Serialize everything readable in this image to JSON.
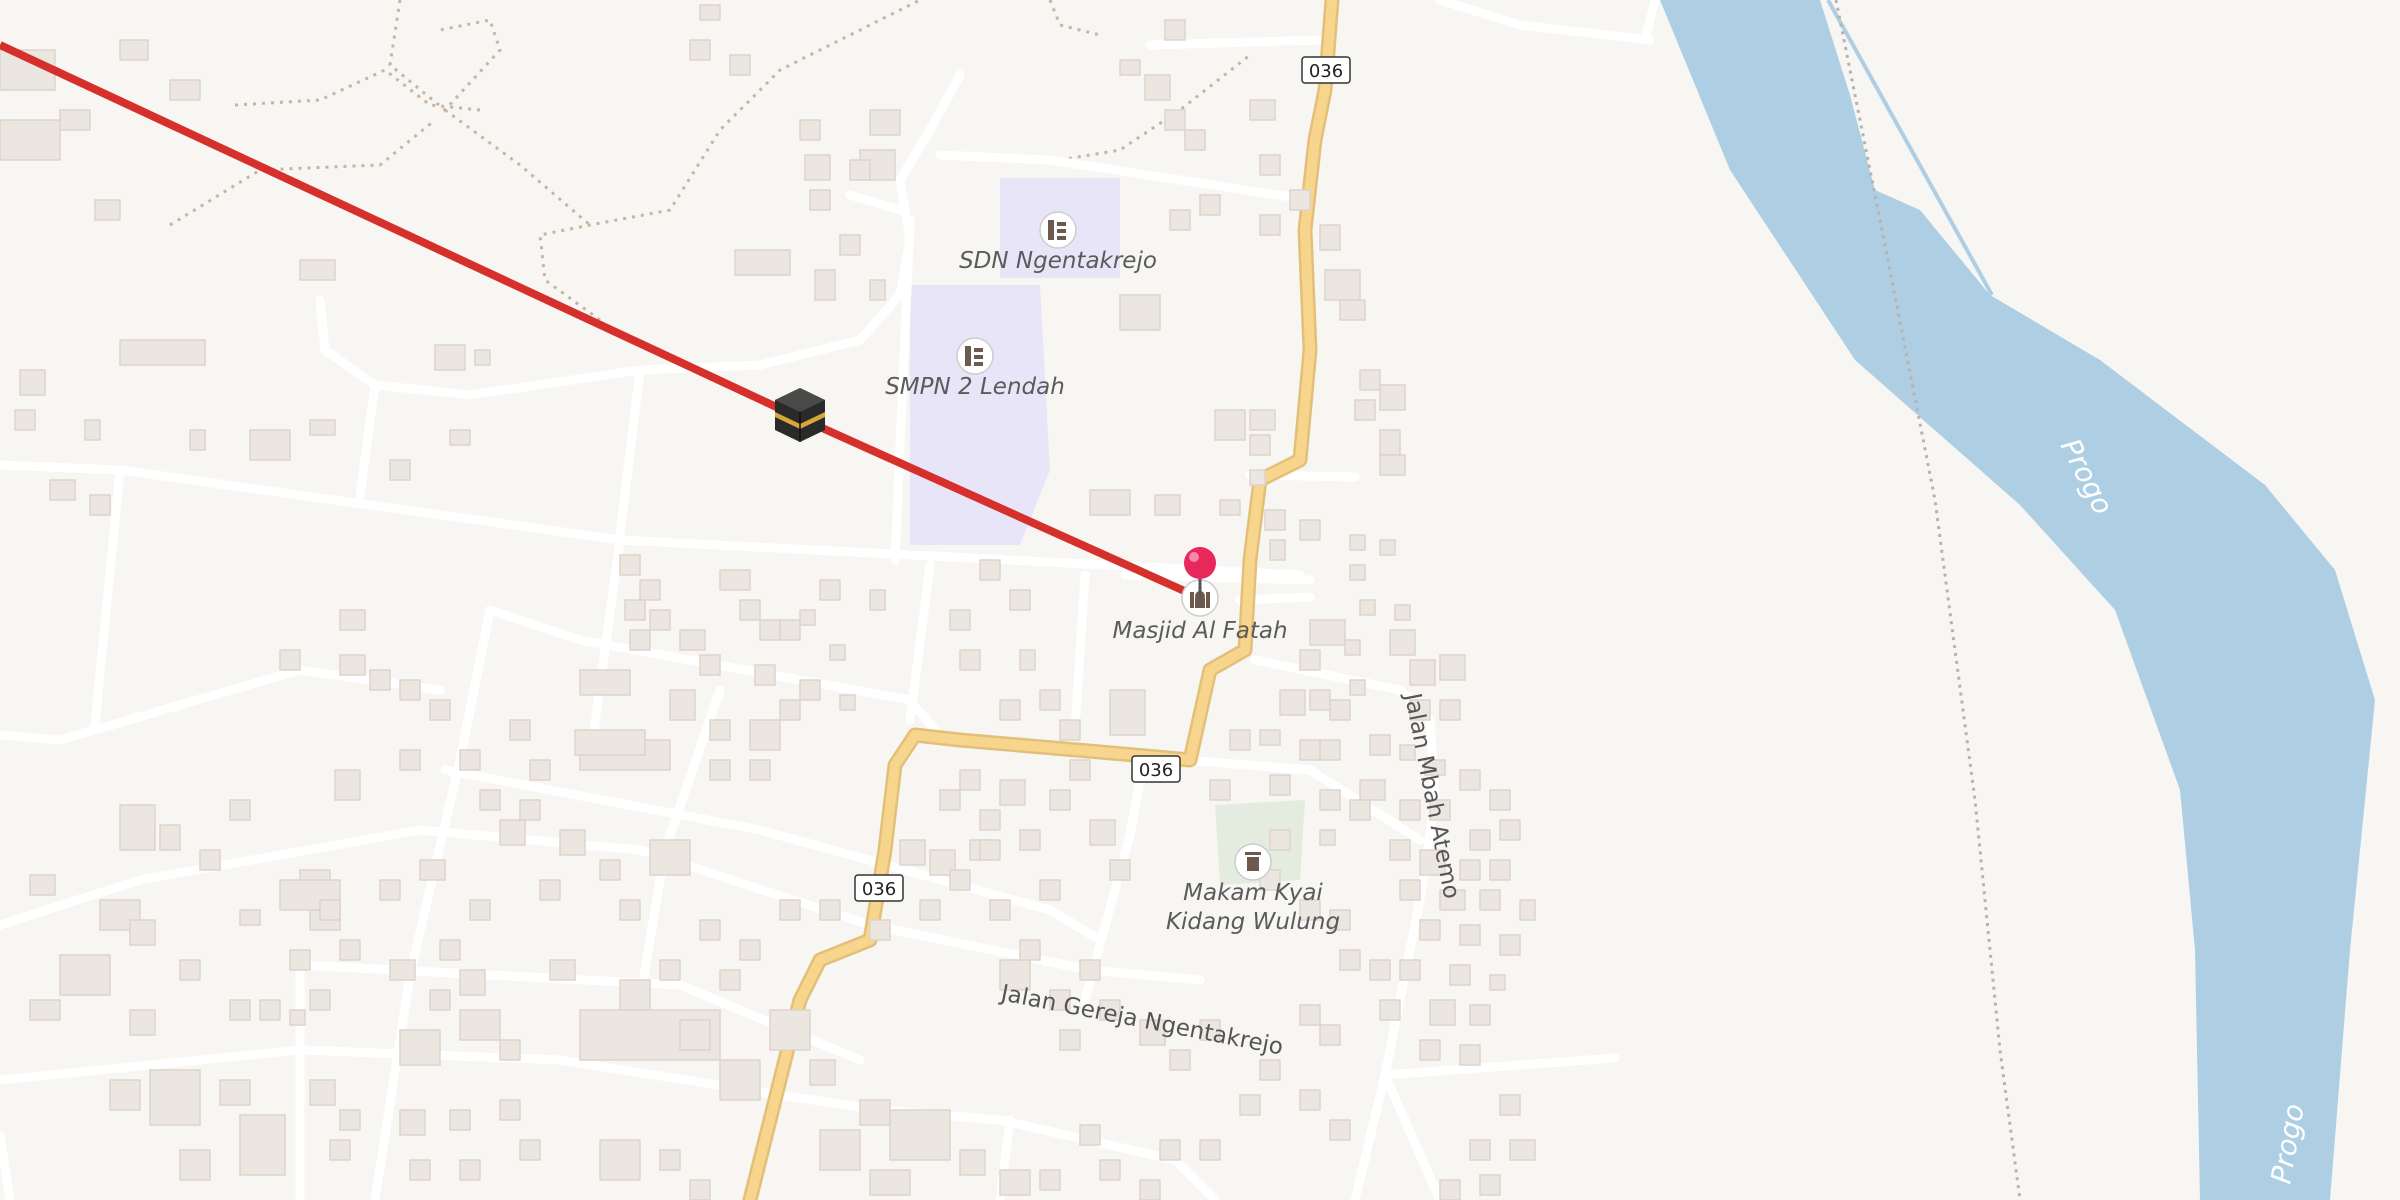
{
  "map": {
    "colors": {
      "background": "#f8f6f3",
      "water": "#aecfe3",
      "road_major": "#f7d58c",
      "road_minor": "#ffffff",
      "route_line": "#d6302c",
      "pin": "#e8275b",
      "campus": "#e9e5f8"
    },
    "route_shields": [
      {
        "label": "036"
      },
      {
        "label": "036"
      },
      {
        "label": "036"
      }
    ],
    "pois": [
      {
        "name": "SDN Ngentakrejo",
        "icon": "school-icon"
      },
      {
        "name": "SMPN 2 Lendah",
        "icon": "school-icon"
      },
      {
        "name": "Masjid Al Fatah",
        "icon": "mosque-icon"
      },
      {
        "line1": "Makam Kyai",
        "line2": "Kidang Wulung",
        "icon": "cemetery-icon"
      }
    ],
    "streets": [
      {
        "name": "Jalan Mbah Atemo"
      },
      {
        "name": "Jalan Gereja Ngentakrejo"
      }
    ],
    "river": {
      "name": "Progo",
      "name2": "Progo"
    },
    "markers": {
      "kaaba": "kaaba-icon",
      "pin": "location-pin-icon"
    }
  }
}
